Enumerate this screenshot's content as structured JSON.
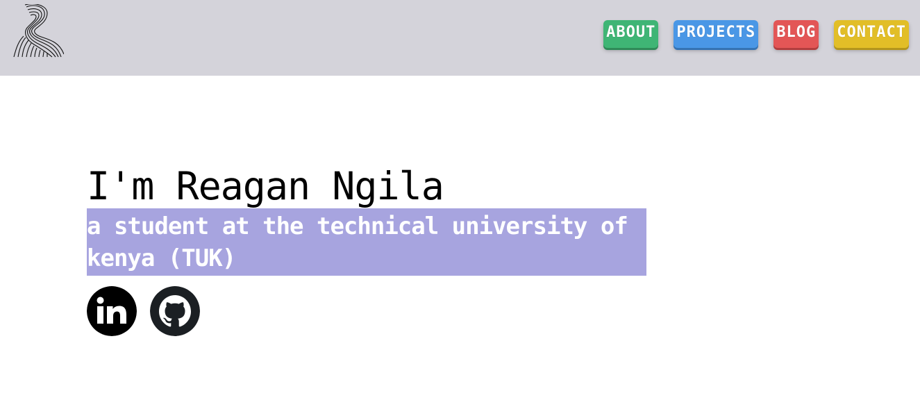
{
  "header": {
    "logo_icon": "fingerprint-silhouette-logo",
    "nav": [
      {
        "label": "ABOUT",
        "color": "#3fb575"
      },
      {
        "label": "PROJECTS",
        "color": "#4a97e6"
      },
      {
        "label": "BLOG",
        "color": "#e35656"
      },
      {
        "label": "CONTACT",
        "color": "#e2be27"
      }
    ],
    "background": "#d4d3da"
  },
  "hero": {
    "title": "I'm Reagan Ngila",
    "subtitle": "a student at the technical university of kenya (TUK)",
    "subtitle_bg": "#a7a4df"
  },
  "socials": [
    {
      "icon": "linkedin-icon"
    },
    {
      "icon": "github-icon"
    }
  ]
}
